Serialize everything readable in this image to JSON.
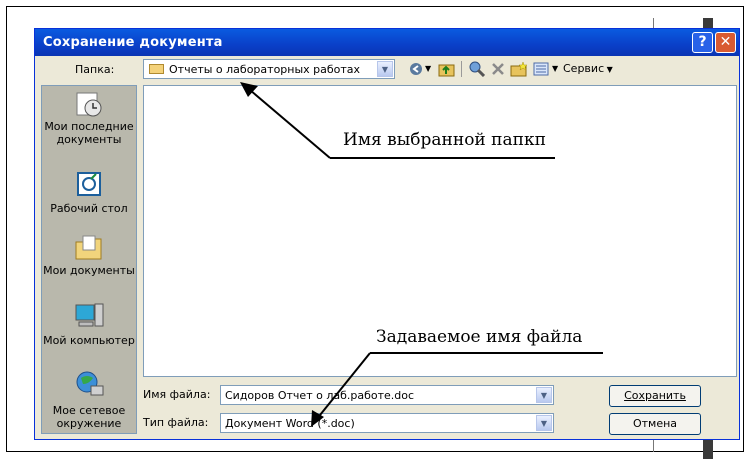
{
  "dialog": {
    "title": "Сохранение документа",
    "help_symbol": "?",
    "close_symbol": "✕",
    "folder_label": "Папка:",
    "folder_value": "Отчеты о лабораторных работах",
    "toolbar": {
      "tools_label": "Сервис",
      "icons": [
        "back-icon",
        "up-folder-icon",
        "search-web-icon",
        "delete-icon",
        "new-folder-icon",
        "views-icon"
      ]
    },
    "places": [
      {
        "label": "Мои последние документы",
        "icon": "recent-documents-icon"
      },
      {
        "label": "Рабочий стол",
        "icon": "desktop-icon"
      },
      {
        "label": "Мои документы",
        "icon": "my-documents-icon"
      },
      {
        "label": "Мой компьютер",
        "icon": "my-computer-icon"
      },
      {
        "label": "Мое сетевое окружение",
        "icon": "network-places-icon"
      }
    ],
    "filename_label": "Имя файла:",
    "filename_value": "Сидоров Отчет о лаб.работе.doc",
    "filetype_label": "Тип файла:",
    "filetype_value": "Документ Word (*.doc)",
    "save_button": "Сохранить",
    "cancel_button": "Отмена"
  },
  "annotations": {
    "folder_note": "Имя выбранной папкп",
    "filename_note": "Задаваемое имя файла"
  },
  "colors": {
    "titlebar": "#0a3fc8",
    "dialog_bg": "#ece9d8",
    "sidebar_bg": "#b9b8ac",
    "close_button": "#d95b32"
  }
}
